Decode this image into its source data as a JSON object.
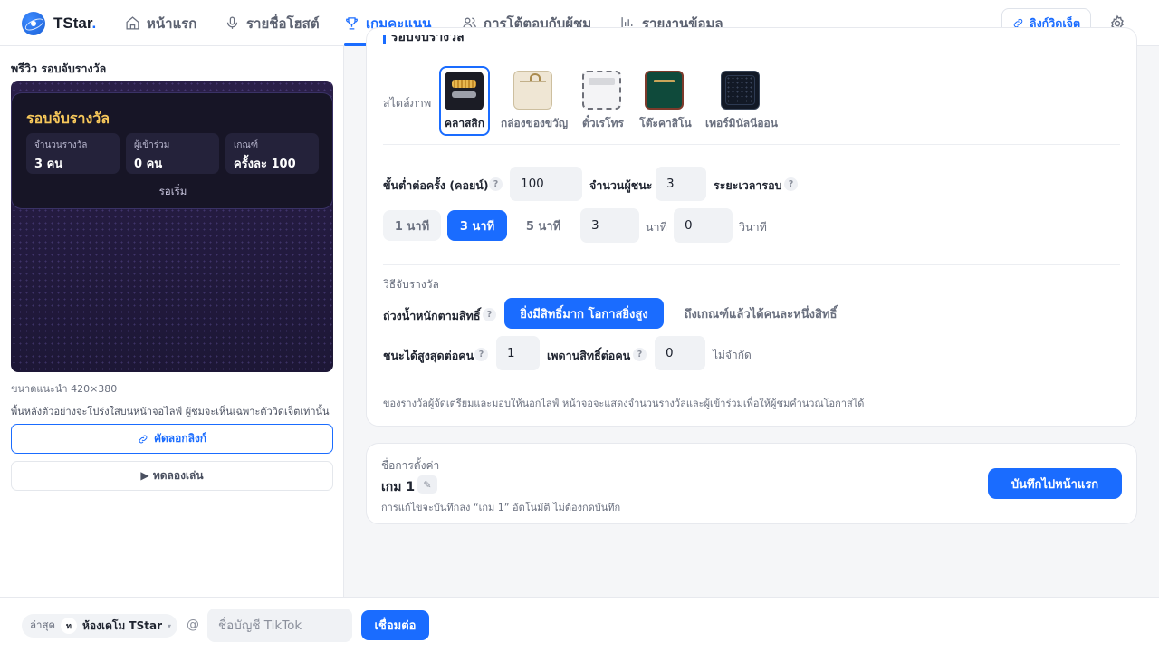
{
  "app": {
    "name": "TStar"
  },
  "nav": {
    "items": [
      {
        "label": "หน้าแรก",
        "icon": "home-icon"
      },
      {
        "label": "รายชื่อโฮสต์",
        "icon": "microphone-icon"
      },
      {
        "label": "เกมคะแนน",
        "icon": "trophy-icon",
        "active": true
      },
      {
        "label": "การโต้ตอบกับผู้ชม",
        "icon": "users-icon"
      },
      {
        "label": "รายงานข้อมูล",
        "icon": "bar-chart-icon"
      }
    ],
    "widget_link_label": "ลิงก์วิดเจ็ต"
  },
  "preview": {
    "title": "พรีวิว รอบจับรางวัล",
    "card_title": "รอบจับรางวัล",
    "stats": [
      {
        "label": "จำนวนรางวัล",
        "value": "3 คน"
      },
      {
        "label": "ผู้เข้าร่วม",
        "value": "0 คน"
      },
      {
        "label": "เกณฑ์",
        "value": "ครั้งละ 100"
      }
    ],
    "status": "รอเริ่ม",
    "size_hint": "ขนาดแนะนำ 420×380",
    "bg_hint": "พื้นหลังตัวอย่างจะโปร่งใสบนหน้าจอไลฟ์ ผู้ชมจะเห็นเฉพาะตัววิดเจ็ตเท่านั้น",
    "copy_link_label": "คัดลอกลิงก์",
    "test_play_label": "▶ ทดลองเล่น"
  },
  "settings": {
    "section_title": "รอบจับรางวัล",
    "style_label": "สไตล์ภาพ",
    "styles": [
      {
        "name": "คลาสสิก",
        "selected": true
      },
      {
        "name": "กล่องของขวัญ"
      },
      {
        "name": "ตั๋วเรโทร"
      },
      {
        "name": "โต๊ะคาสิโน"
      },
      {
        "name": "เทอร์มินัลนีออน"
      }
    ],
    "min_per_time_label": "ขั้นต่ำต่อครั้ง (คอยน์)",
    "min_per_time_value": "100",
    "winners_label": "จำนวนผู้ชนะ",
    "winners_value": "3",
    "duration_label": "ระยะเวลารอบ",
    "duration_presets": [
      "1 นาที",
      "3 นาที",
      "5 นาที"
    ],
    "duration_active_index": 1,
    "minutes_value": "3",
    "minutes_unit": "นาที",
    "seconds_value": "0",
    "seconds_unit": "วินาที",
    "method_heading": "วิธีจับรางวัล",
    "weight_label": "ถ่วงน้ำหนักตามสิทธิ์",
    "weight_options": [
      "ยิ่งมีสิทธิ์มาก โอกาสยิ่งสูง",
      "ถึงเกณฑ์แล้วได้คนละหนึ่งสิทธิ์"
    ],
    "max_wins_label": "ชนะได้สูงสุดต่อคน",
    "max_wins_value": "1",
    "entries_cap_label": "เพดานสิทธิ์ต่อคน",
    "entries_cap_value": "0",
    "entries_cap_hint": "ไม่จำกัด",
    "tip": "ของรางวัลผู้จัดเตรียมและมอบให้นอกไลฟ์ หน้าจอจะแสดงจำนวนรางวัลและผู้เข้าร่วมเพื่อให้ผู้ชมคำนวณโอกาสได้",
    "help_glyph": "?"
  },
  "save": {
    "name_label": "ชื่อการตั้งค่า",
    "name": "เกม 1",
    "edit_glyph": "✎",
    "note": "การแก้ไขจะบันทึกลง “เกม 1” อัตโนมัติ ไม่ต้องกดบันทึก",
    "button_label": "บันทึกไปหน้าแรก"
  },
  "bottom": {
    "latest_label": "ล่าสุด",
    "room_initial": "ท",
    "room_name": "ห้องเดโม TStar",
    "caret": "▾",
    "at": "@",
    "tiktok_placeholder": "ชื่อบัญชี TikTok",
    "connect_label": "เชื่อมต่อ"
  },
  "colors": {
    "accent": "#1a6cff",
    "prize_gold": "#f6c75a",
    "preview_bg": "#221a3e"
  }
}
